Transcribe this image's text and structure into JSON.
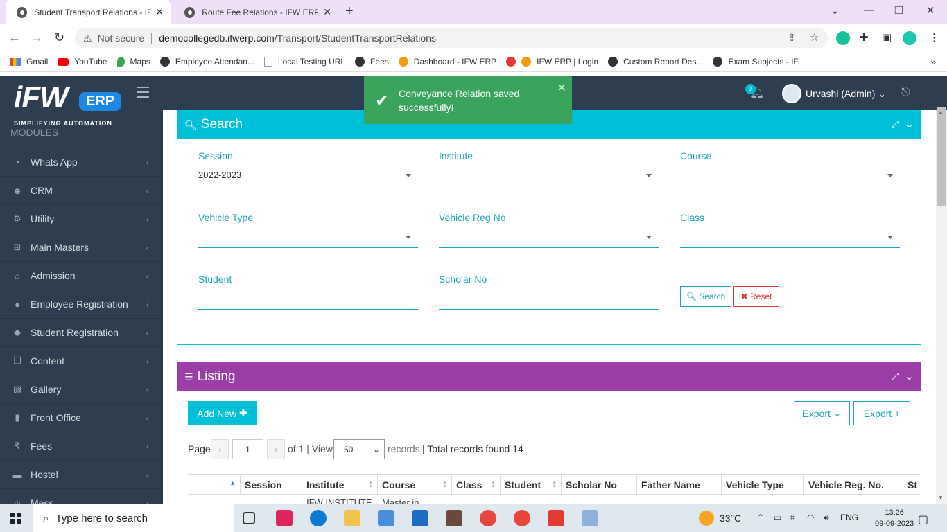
{
  "browser": {
    "tabs": [
      {
        "title": "Student Transport Relations - IFW ERP",
        "active": true
      },
      {
        "title": "Route Fee Relations - IFW ERP",
        "active": false
      }
    ],
    "not_secure": "Not secure",
    "url_host": "democollegedb.ifwerp.com",
    "url_path": "/Transport/StudentTransportRelations",
    "bookmarks": [
      "Gmail",
      "YouTube",
      "Maps",
      "Employee Attendan...",
      "Local Testing URL",
      "Fees",
      "Dashboard - IFW ERP",
      "IFW ERP | Login",
      "Custom Report Des...",
      "Exam Subjects - IF..."
    ]
  },
  "app": {
    "logo_text": "iFW",
    "logo_badge": "ERP",
    "logo_tagline": "SIMPLIFYING AUTOMATION",
    "modules_label": "MODULES",
    "menu": [
      {
        "label": "Whats App",
        "icon": "whatsapp-icon"
      },
      {
        "label": "CRM",
        "icon": "users-icon"
      },
      {
        "label": "Utility",
        "icon": "cogs-icon"
      },
      {
        "label": "Main Masters",
        "icon": "sitemap-icon"
      },
      {
        "label": "Admission",
        "icon": "bank-icon"
      },
      {
        "label": "Employee Registration",
        "icon": "user-icon"
      },
      {
        "label": "Student Registration",
        "icon": "graduation-cap-icon"
      },
      {
        "label": "Content",
        "icon": "copy-icon"
      },
      {
        "label": "Gallery",
        "icon": "image-icon"
      },
      {
        "label": "Front Office",
        "icon": "building-icon"
      },
      {
        "label": "Fees",
        "icon": "rupee-icon"
      },
      {
        "label": "Hostel",
        "icon": "bed-icon"
      },
      {
        "label": "Mess",
        "icon": "cutlery-icon"
      }
    ],
    "notifications_count": "0",
    "user_name": "Urvashi (Admin)"
  },
  "toast": {
    "message": "Conveyance Relation saved successfully!"
  },
  "search_panel": {
    "title": "Search",
    "fields": {
      "session_label": "Session",
      "session_value": "2022-2023",
      "institute_label": "Institute",
      "course_label": "Course",
      "vehicle_type_label": "Vehicle Type",
      "vehicle_reg_label": "Vehicle Reg No .",
      "class_label": "Class",
      "student_label": "Student",
      "scholar_label": "Scholar No"
    },
    "search_button": "Search",
    "reset_button": "Reset"
  },
  "listing_panel": {
    "title": "Listing",
    "add_new": "Add New",
    "export_dropdown": "Export",
    "export_plus": "Export +",
    "page_label": "Page",
    "page_value": "1",
    "of_label": "of 1 | View",
    "view_value": "50",
    "records_label": "records",
    "total_label": "| Total records found 14",
    "columns": [
      "",
      "Session",
      "Institute",
      "Course",
      "Class",
      "Student",
      "Scholar No",
      "Father Name",
      "Vehicle Type",
      "Vehicle Reg. No.",
      "St"
    ],
    "first_row_partial": {
      "institute": "IFW INSTITUTE",
      "course": "Master in"
    }
  },
  "colors": {
    "sidebar": "#2c3e50",
    "search_header": "#00c0d8",
    "listing_header": "#9c3ea8",
    "accent": "#1ca7b8",
    "toast": "#3aa35c"
  },
  "taskbar": {
    "search_placeholder": "Type here to search",
    "weather": "33°C",
    "language": "ENG",
    "time": "13:26",
    "date": "09-09-2023"
  }
}
